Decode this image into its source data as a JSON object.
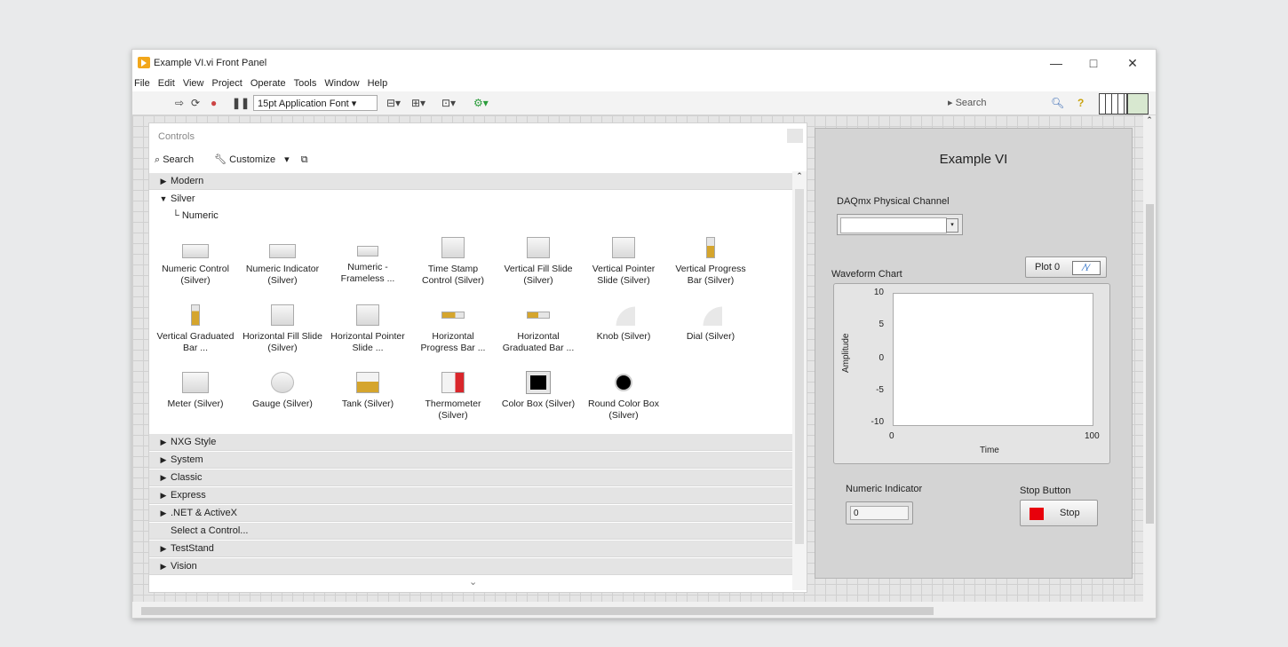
{
  "window": {
    "title": "Example VI.vi Front Panel",
    "min": "—",
    "max": "□",
    "close": "✕"
  },
  "menu": [
    "File",
    "Edit",
    "View",
    "Project",
    "Operate",
    "Tools",
    "Window",
    "Help"
  ],
  "toolbar": {
    "font": "15pt Application Font",
    "search_placeholder": "Search"
  },
  "palette": {
    "title": "Controls",
    "search": "Search",
    "customize": "Customize",
    "categories_top": [
      {
        "label": "Modern",
        "arrow": "▶"
      },
      {
        "label": "Silver",
        "arrow": "▼"
      }
    ],
    "sub": "Numeric",
    "items": [
      "Numeric Control (Silver)",
      "Numeric Indicator (Silver)",
      "Numeric - Frameless ...",
      "Time Stamp Control (Silver)",
      "Vertical Fill Slide (Silver)",
      "Vertical Pointer Slide (Silver)",
      "Vertical Progress Bar (Silver)",
      "Vertical Graduated Bar ...",
      "Horizontal Fill Slide (Silver)",
      "Horizontal Pointer Slide ...",
      "Horizontal Progress Bar ...",
      "Horizontal Graduated Bar ...",
      "Knob (Silver)",
      "Dial (Silver)",
      "Meter (Silver)",
      "Gauge (Silver)",
      "Tank (Silver)",
      "Thermometer (Silver)",
      "Color Box (Silver)",
      "Round Color Box (Silver)"
    ],
    "categories_bottom": [
      {
        "label": "NXG Style",
        "arrow": "▶"
      },
      {
        "label": "System",
        "arrow": "▶"
      },
      {
        "label": "Classic",
        "arrow": "▶"
      },
      {
        "label": "Express",
        "arrow": "▶"
      },
      {
        "label": ".NET & ActiveX",
        "arrow": "▶"
      },
      {
        "label": "Select a Control...",
        "arrow": ""
      },
      {
        "label": "TestStand",
        "arrow": "▶"
      },
      {
        "label": "Vision",
        "arrow": "▶"
      }
    ],
    "more": "⌄"
  },
  "panel": {
    "title": "Example VI",
    "daq_label": "DAQmx Physical Channel",
    "chart_label": "Waveform Chart",
    "plot_legend": "Plot 0",
    "y_label": "Amplitude",
    "x_label": "Time",
    "y_ticks": [
      "10",
      "5",
      "0",
      "-5",
      "-10"
    ],
    "x_ticks": [
      "0",
      "100"
    ],
    "numeric_label": "Numeric Indicator",
    "numeric_value": "0",
    "stop_label": "Stop Button",
    "stop_text": "Stop"
  },
  "colors": {
    "stop_red": "#e8000b",
    "palette_header": "#e4e4e4"
  }
}
